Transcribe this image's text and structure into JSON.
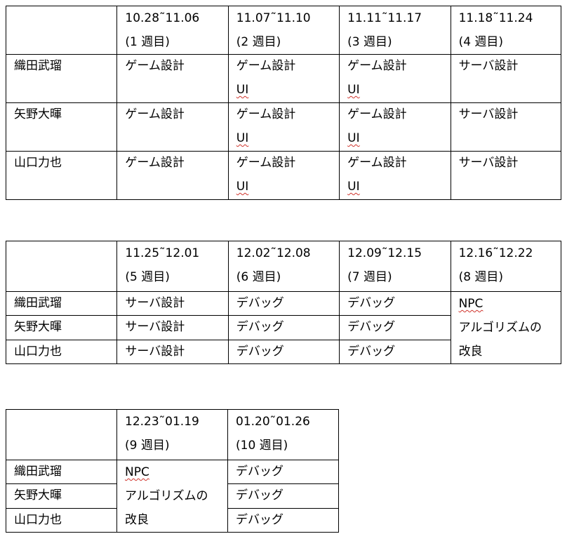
{
  "members": [
    "織田武瑠",
    "矢野大暉",
    "山口力也"
  ],
  "table1": {
    "weeks": [
      {
        "range": "10.28˜11.06",
        "label": "(1 週目)"
      },
      {
        "range": "11.07˜11.10",
        "label": "(2 週目)"
      },
      {
        "range": "11.11˜11.17",
        "label": "(3 週目)"
      },
      {
        "range": "11.18˜11.24",
        "label": "(4 週目)"
      }
    ],
    "task_game": "ゲーム設計",
    "task_ui": "UI",
    "task_server": "サーバ設計"
  },
  "table2": {
    "weeks": [
      {
        "range": "11.25˜12.01",
        "label": "(5 週目)"
      },
      {
        "range": "12.02˜12.08",
        "label": "(6 週目)"
      },
      {
        "range": "12.09˜12.15",
        "label": "(7 週目)"
      },
      {
        "range": "12.16˜12.22",
        "label": "(8 週目)"
      }
    ],
    "task_server": "サーバ設計",
    "task_debug": "デバッグ",
    "npc_line1": "NPC",
    "npc_line2": "アルゴリズムの",
    "npc_line3": "改良"
  },
  "table3": {
    "weeks": [
      {
        "range": "12.23˜01.19",
        "label": "(9 週目)"
      },
      {
        "range": "01.20˜01.26",
        "label": "(10 週目)"
      }
    ],
    "task_debug": "デバッグ",
    "npc_line1": "NPC",
    "npc_line2": "アルゴリズムの",
    "npc_line3": "改良"
  }
}
